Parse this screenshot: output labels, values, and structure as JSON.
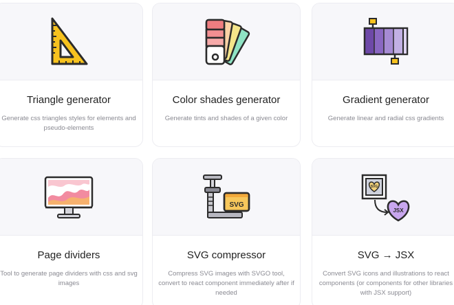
{
  "cards": [
    {
      "title": "Triangle generator",
      "description": "Generate css triangles styles for elements and pseudo-elements",
      "icon": "triangle-ruler-icon"
    },
    {
      "title": "Color shades generator",
      "description": "Generate tints and shades of a given color",
      "icon": "color-swatch-fan-icon"
    },
    {
      "title": "Gradient generator",
      "description": "Generate linear and radial css gradients",
      "icon": "gradient-stops-icon"
    },
    {
      "title": "Page dividers",
      "description": "Tool to generate page dividers with css and svg images",
      "icon": "monitor-wave-icon"
    },
    {
      "title": "SVG compressor",
      "description": "Compress SVG images with SVGO tool, convert to react component immediately after if needed",
      "icon": "clamp-svg-icon"
    },
    {
      "title": "SVG → JSX",
      "description": "Convert SVG icons and illustrations to react components (or components for other libraries with JSX support)",
      "icon": "svg-to-jsx-icon"
    }
  ],
  "icon_text": {
    "svg": "SVG",
    "jsx": "JSX"
  },
  "colors": {
    "card_border": "#ececf1",
    "card_top_bg": "#f7f7fa",
    "title": "#222222",
    "description": "#8a8a92"
  }
}
